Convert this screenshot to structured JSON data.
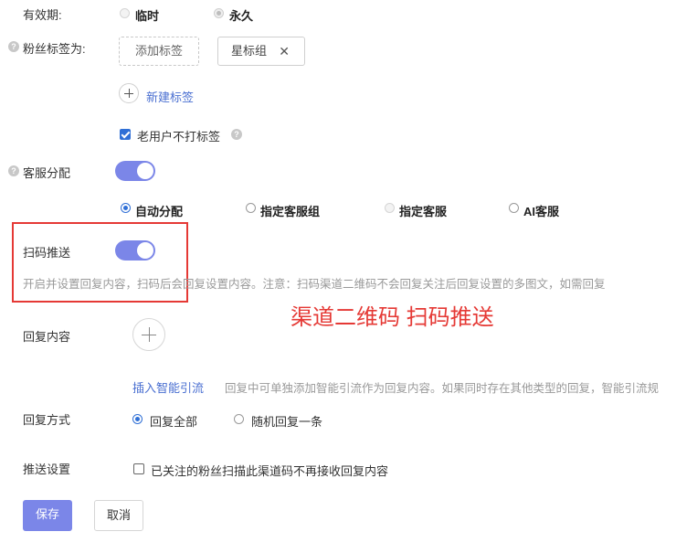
{
  "validity": {
    "label": "有效期:",
    "options": [
      "临时",
      "永久"
    ],
    "selected": "永久"
  },
  "fan_tags": {
    "label": "粉丝标签为:",
    "add_tag": "添加标签",
    "tags": [
      "星标组"
    ],
    "new_tag": "新建标签",
    "old_user_no_tag": "老用户不打标签",
    "old_user_no_tag_checked": true
  },
  "customer_service": {
    "label": "客服分配",
    "enabled": true,
    "options": [
      "自动分配",
      "指定客服组",
      "指定客服",
      "AI客服"
    ],
    "selected": "自动分配"
  },
  "scan_push": {
    "label": "扫码推送",
    "enabled": true,
    "description": "开启并设置回复内容，扫码后会回复设置内容。注意：扫码渠道二维码不会回复关注后回复设置的多图文，如需回复"
  },
  "annotation": {
    "text": "渠道二维码 扫码推送",
    "color": "#e53935"
  },
  "reply_content": {
    "label": "回复内容",
    "insert_link": "插入智能引流",
    "hint": "回复中可单独添加智能引流作为回复内容。如果同时存在其他类型的回复，智能引流规"
  },
  "reply_mode": {
    "label": "回复方式",
    "options": [
      "回复全部",
      "随机回复一条"
    ],
    "selected": "回复全部"
  },
  "push_settings": {
    "label": "推送设置",
    "option": "已关注的粉丝扫描此渠道码不再接收回复内容",
    "checked": false
  },
  "actions": {
    "save": "保存",
    "cancel": "取消"
  },
  "colors": {
    "accent": "#7b86e8",
    "link": "#4a6fd1",
    "highlight_border": "#e53935"
  }
}
